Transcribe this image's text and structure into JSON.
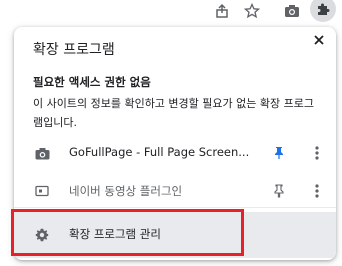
{
  "toolbar": {
    "icons": [
      "share-icon",
      "star-icon",
      "camera-icon",
      "puzzle-icon"
    ]
  },
  "popup": {
    "title": "확장 프로그램",
    "close_icon": "close-icon",
    "section_heading": "필요한 액세스 권한 없음",
    "section_desc": "이 사이트의 정보를 확인하고 변경할 필요가 없는 확장 프로그램입니다.",
    "extensions": [
      {
        "name": "GoFullPage - Full Page Screen...",
        "icon": "camera-icon",
        "pinned": true
      },
      {
        "name": "네이버 동영상 플러그인",
        "icon": "video-icon",
        "pinned": false
      }
    ],
    "manage_label": "확장 프로그램 관리",
    "manage_icon": "gear-icon"
  },
  "colors": {
    "pin_active": "#1a73e8",
    "icon_gray": "#5f6368",
    "highlight": "#e8202a",
    "manage_bg": "#e8eaed"
  }
}
